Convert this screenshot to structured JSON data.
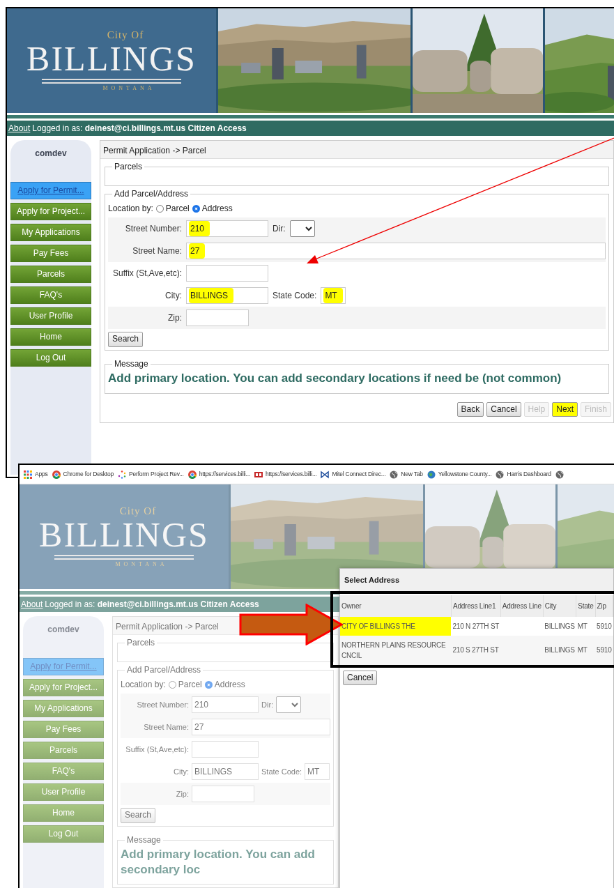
{
  "screenshot_1": {
    "dimmed": false,
    "logo": {
      "city_of": "City Of",
      "name": "BILLINGS",
      "state": "MONTANA"
    },
    "user_bar": {
      "about": "About",
      "text": "Logged in as: **deinest@ci.billings.mt.us Citizen Access**"
    },
    "sidebar": {
      "header": "comdev",
      "items": [
        {
          "label": "Apply for Permit...",
          "selected": true
        },
        {
          "label": "Apply for Project...",
          "selected": false
        },
        {
          "label": "My Applications",
          "selected": false
        },
        {
          "label": "Pay Fees",
          "selected": false
        },
        {
          "label": "Parcels",
          "selected": false
        },
        {
          "label": "FAQ's",
          "selected": false
        },
        {
          "label": "User Profile",
          "selected": false
        },
        {
          "label": "Home",
          "selected": false
        },
        {
          "label": "Log Out",
          "selected": false
        }
      ]
    },
    "breadcrumb": "Permit Application -> Parcel",
    "parcels_legend": "Parcels",
    "address_legend": "Add Parcel/Address",
    "location_by": {
      "label": "Location by:",
      "options": [
        {
          "label": "Parcel",
          "selected": false
        },
        {
          "label": "Address",
          "selected": true
        }
      ]
    },
    "rows": [
      {
        "fields": [
          {
            "kind": "text",
            "label": "Street Number:",
            "value": "210",
            "highlighted": true
          },
          {
            "kind": "select",
            "label": "Dir:"
          }
        ]
      },
      {
        "fields": [
          {
            "kind": "wide",
            "label": "Street Name:",
            "value": "27",
            "highlighted": true
          }
        ]
      },
      {
        "fields": [
          {
            "kind": "text",
            "label": "Suffix (St,Ave,etc):"
          }
        ]
      },
      {
        "fields": [
          {
            "kind": "text",
            "label": "City:",
            "value": "BILLINGS",
            "highlighted": true
          },
          {
            "kind": "short",
            "label": "State Code:",
            "value": "MT",
            "highlighted": true
          }
        ]
      },
      {
        "fields": [
          {
            "kind": "medium",
            "label": "Zip:"
          }
        ]
      }
    ],
    "search_button": "Search",
    "message": {
      "legend": "Message",
      "text": "Add primary location. You can add secondary locations if need be (not common)"
    },
    "buttons": [
      {
        "label": "Back",
        "disabled": false,
        "highlighted": false
      },
      {
        "label": "Cancel",
        "disabled": false,
        "highlighted": false
      },
      {
        "label": "Help",
        "disabled": true,
        "highlighted": false
      },
      {
        "label": "Next",
        "disabled": false,
        "highlighted": true
      },
      {
        "label": "Finish",
        "disabled": true,
        "highlighted": false
      }
    ]
  },
  "screenshot_2": {
    "dimmed": true,
    "bookmarks": [
      {
        "kind": "grid",
        "label": "Apps"
      },
      {
        "kind": "chrome",
        "label": "Chrome for Desktop"
      },
      {
        "kind": "spinner",
        "label": "Perform Project Rev..."
      },
      {
        "kind": "chrome",
        "label": "https://services.billi..."
      },
      {
        "kind": "redlogo",
        "label": "https://services.billi..."
      },
      {
        "kind": "bowtie",
        "label": "Mitel Connect Direc..."
      },
      {
        "kind": "globe",
        "label": "New Tab"
      },
      {
        "kind": "earth",
        "label": "Yellowstone County..."
      },
      {
        "kind": "globe",
        "label": "Harris Dashboard"
      },
      {
        "kind": "globe"
      }
    ],
    "logo": {
      "city_of": "City Of",
      "name": "BILLINGS",
      "state": "MONTANA"
    },
    "user_bar": {
      "about": "About",
      "text": "Logged in as: **deinest@ci.billings.mt.us Citizen Access**"
    },
    "sidebar": {
      "header": "comdev",
      "items": [
        {
          "label": "Apply for Permit...",
          "selected": true
        },
        {
          "label": "Apply for Project...",
          "selected": false
        },
        {
          "label": "My Applications",
          "selected": false
        },
        {
          "label": "Pay Fees",
          "selected": false
        },
        {
          "label": "Parcels",
          "selected": false
        },
        {
          "label": "FAQ's",
          "selected": false
        },
        {
          "label": "User Profile",
          "selected": false
        },
        {
          "label": "Home",
          "selected": false
        },
        {
          "label": "Log Out",
          "selected": false
        }
      ]
    },
    "breadcrumb": "Permit Application -> Parcel",
    "parcels_legend": "Parcels",
    "address_legend": "Add Parcel/Address",
    "location_by": {
      "label": "Location by:",
      "options": [
        {
          "label": "Parcel",
          "selected": false
        },
        {
          "label": "Address",
          "selected": true
        }
      ]
    },
    "rows": [
      {
        "fields": [
          {
            "kind": "text",
            "label": "Street Number:",
            "value": "210",
            "highlighted": false
          },
          {
            "kind": "select",
            "label": "Dir:"
          }
        ]
      },
      {
        "fields": [
          {
            "kind": "wide",
            "label": "Street Name:",
            "value": "27",
            "highlighted": false
          }
        ]
      },
      {
        "fields": [
          {
            "kind": "text",
            "label": "Suffix (St,Ave,etc):"
          }
        ]
      },
      {
        "fields": [
          {
            "kind": "text",
            "label": "City:",
            "value": "BILLINGS",
            "highlighted": false
          },
          {
            "kind": "short",
            "label": "State Code:",
            "value": "MT",
            "highlighted": false
          }
        ]
      },
      {
        "fields": [
          {
            "kind": "medium",
            "label": "Zip:"
          }
        ]
      }
    ],
    "search_button": "Search",
    "message": {
      "legend": "Message",
      "text": "Add primary location. You can add secondary loc"
    },
    "dialog": {
      "title": "Select Address",
      "columns": [
        "Owner",
        "Address Line1",
        "Address Line",
        "City",
        "State",
        "Zip"
      ],
      "rows": [
        {
          "owner": "CITY OF BILLINGS THE",
          "address_line1": "210 N 27TH ST",
          "city": "BILLINGS",
          "state": "MT",
          "zip": "5910",
          "highlighted": true
        },
        {
          "owner": "NORTHERN PLAINS RESOURCE CNCIL",
          "address_line1": "210 S 27TH ST",
          "city": "BILLINGS",
          "state": "MT",
          "zip": "5910",
          "highlighted": false
        }
      ],
      "cancel_button": "Cancel"
    }
  },
  "annotations": [
    {
      "kind": "line_arrow"
    },
    {
      "kind": "block_arrow"
    },
    {
      "kind": "frame"
    }
  ]
}
